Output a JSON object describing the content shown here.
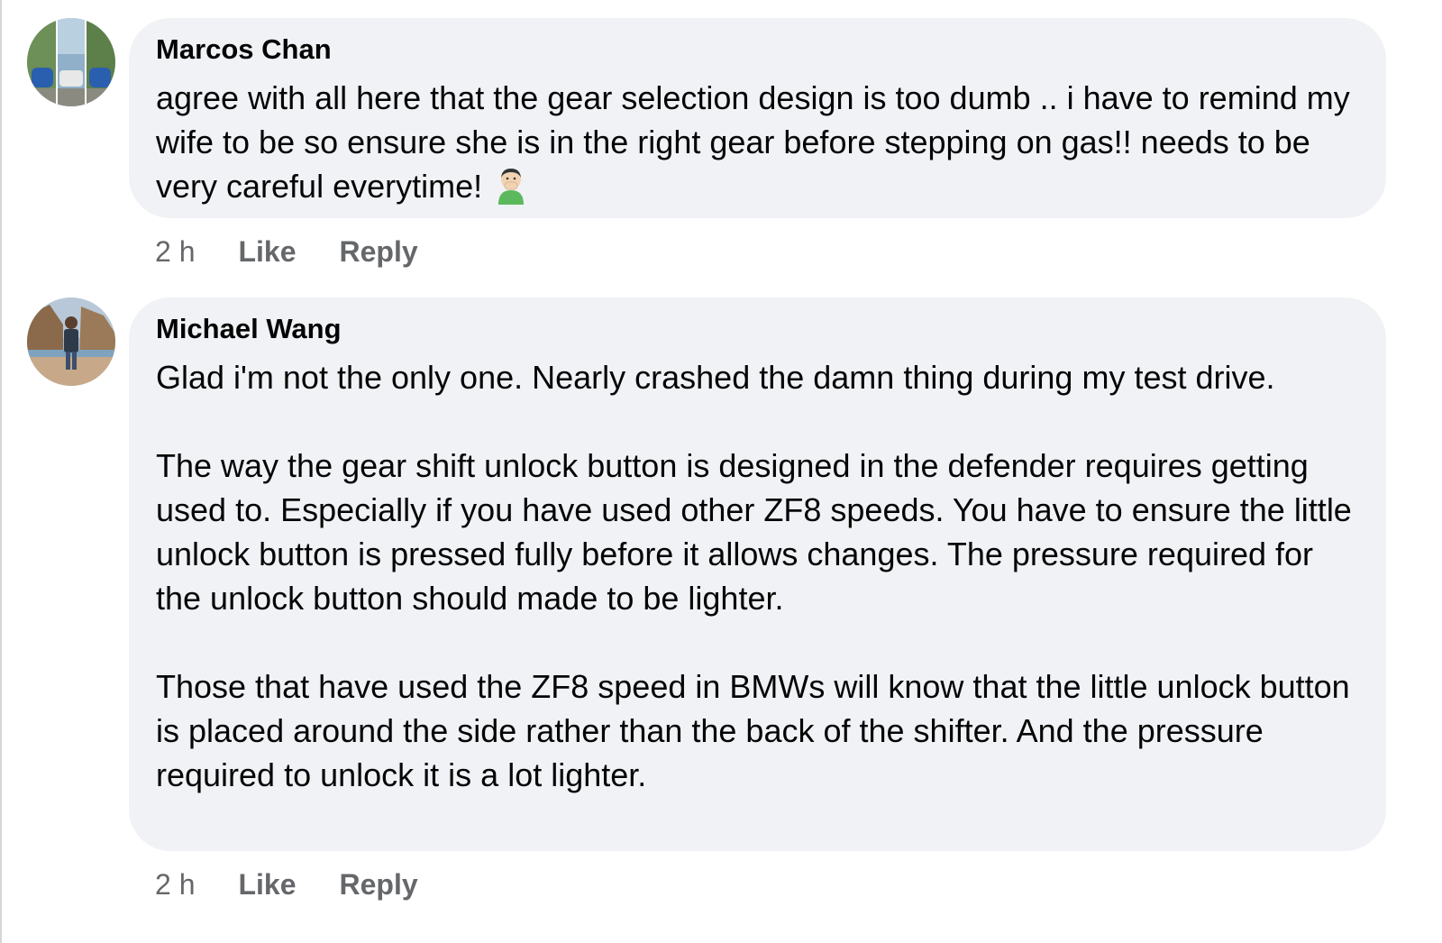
{
  "comments": [
    {
      "author": "Marcos Chan",
      "paragraphs": [
        "agree with all here that the gear selection design is too dumb .. i have to remind my wife to be so ensure she is in the right gear before stepping on gas!! needs to be very careful everytime!"
      ],
      "emoji": "face-with-hand-over-mouth-person-icon",
      "time": "2 h",
      "like_label": "Like",
      "reply_label": "Reply"
    },
    {
      "author": "Michael Wang",
      "paragraphs": [
        "Glad i'm not the only one. Nearly crashed the damn thing during my test drive.",
        "The way the gear shift unlock button is designed in the defender requires getting used to. Especially if you have used other ZF8 speeds. You have to ensure the little unlock button is pressed fully before it allows changes. The pressure required for the unlock button should made to be lighter.",
        "Those that have used the ZF8 speed in BMWs will know that the little unlock button is placed around the side rather than the back of the shifter. And the pressure required to unlock it is a lot lighter."
      ],
      "time": "2 h",
      "like_label": "Like",
      "reply_label": "Reply"
    }
  ],
  "colors": {
    "bubble": "#f0f2f5",
    "text": "#050505",
    "meta": "#65676b"
  }
}
